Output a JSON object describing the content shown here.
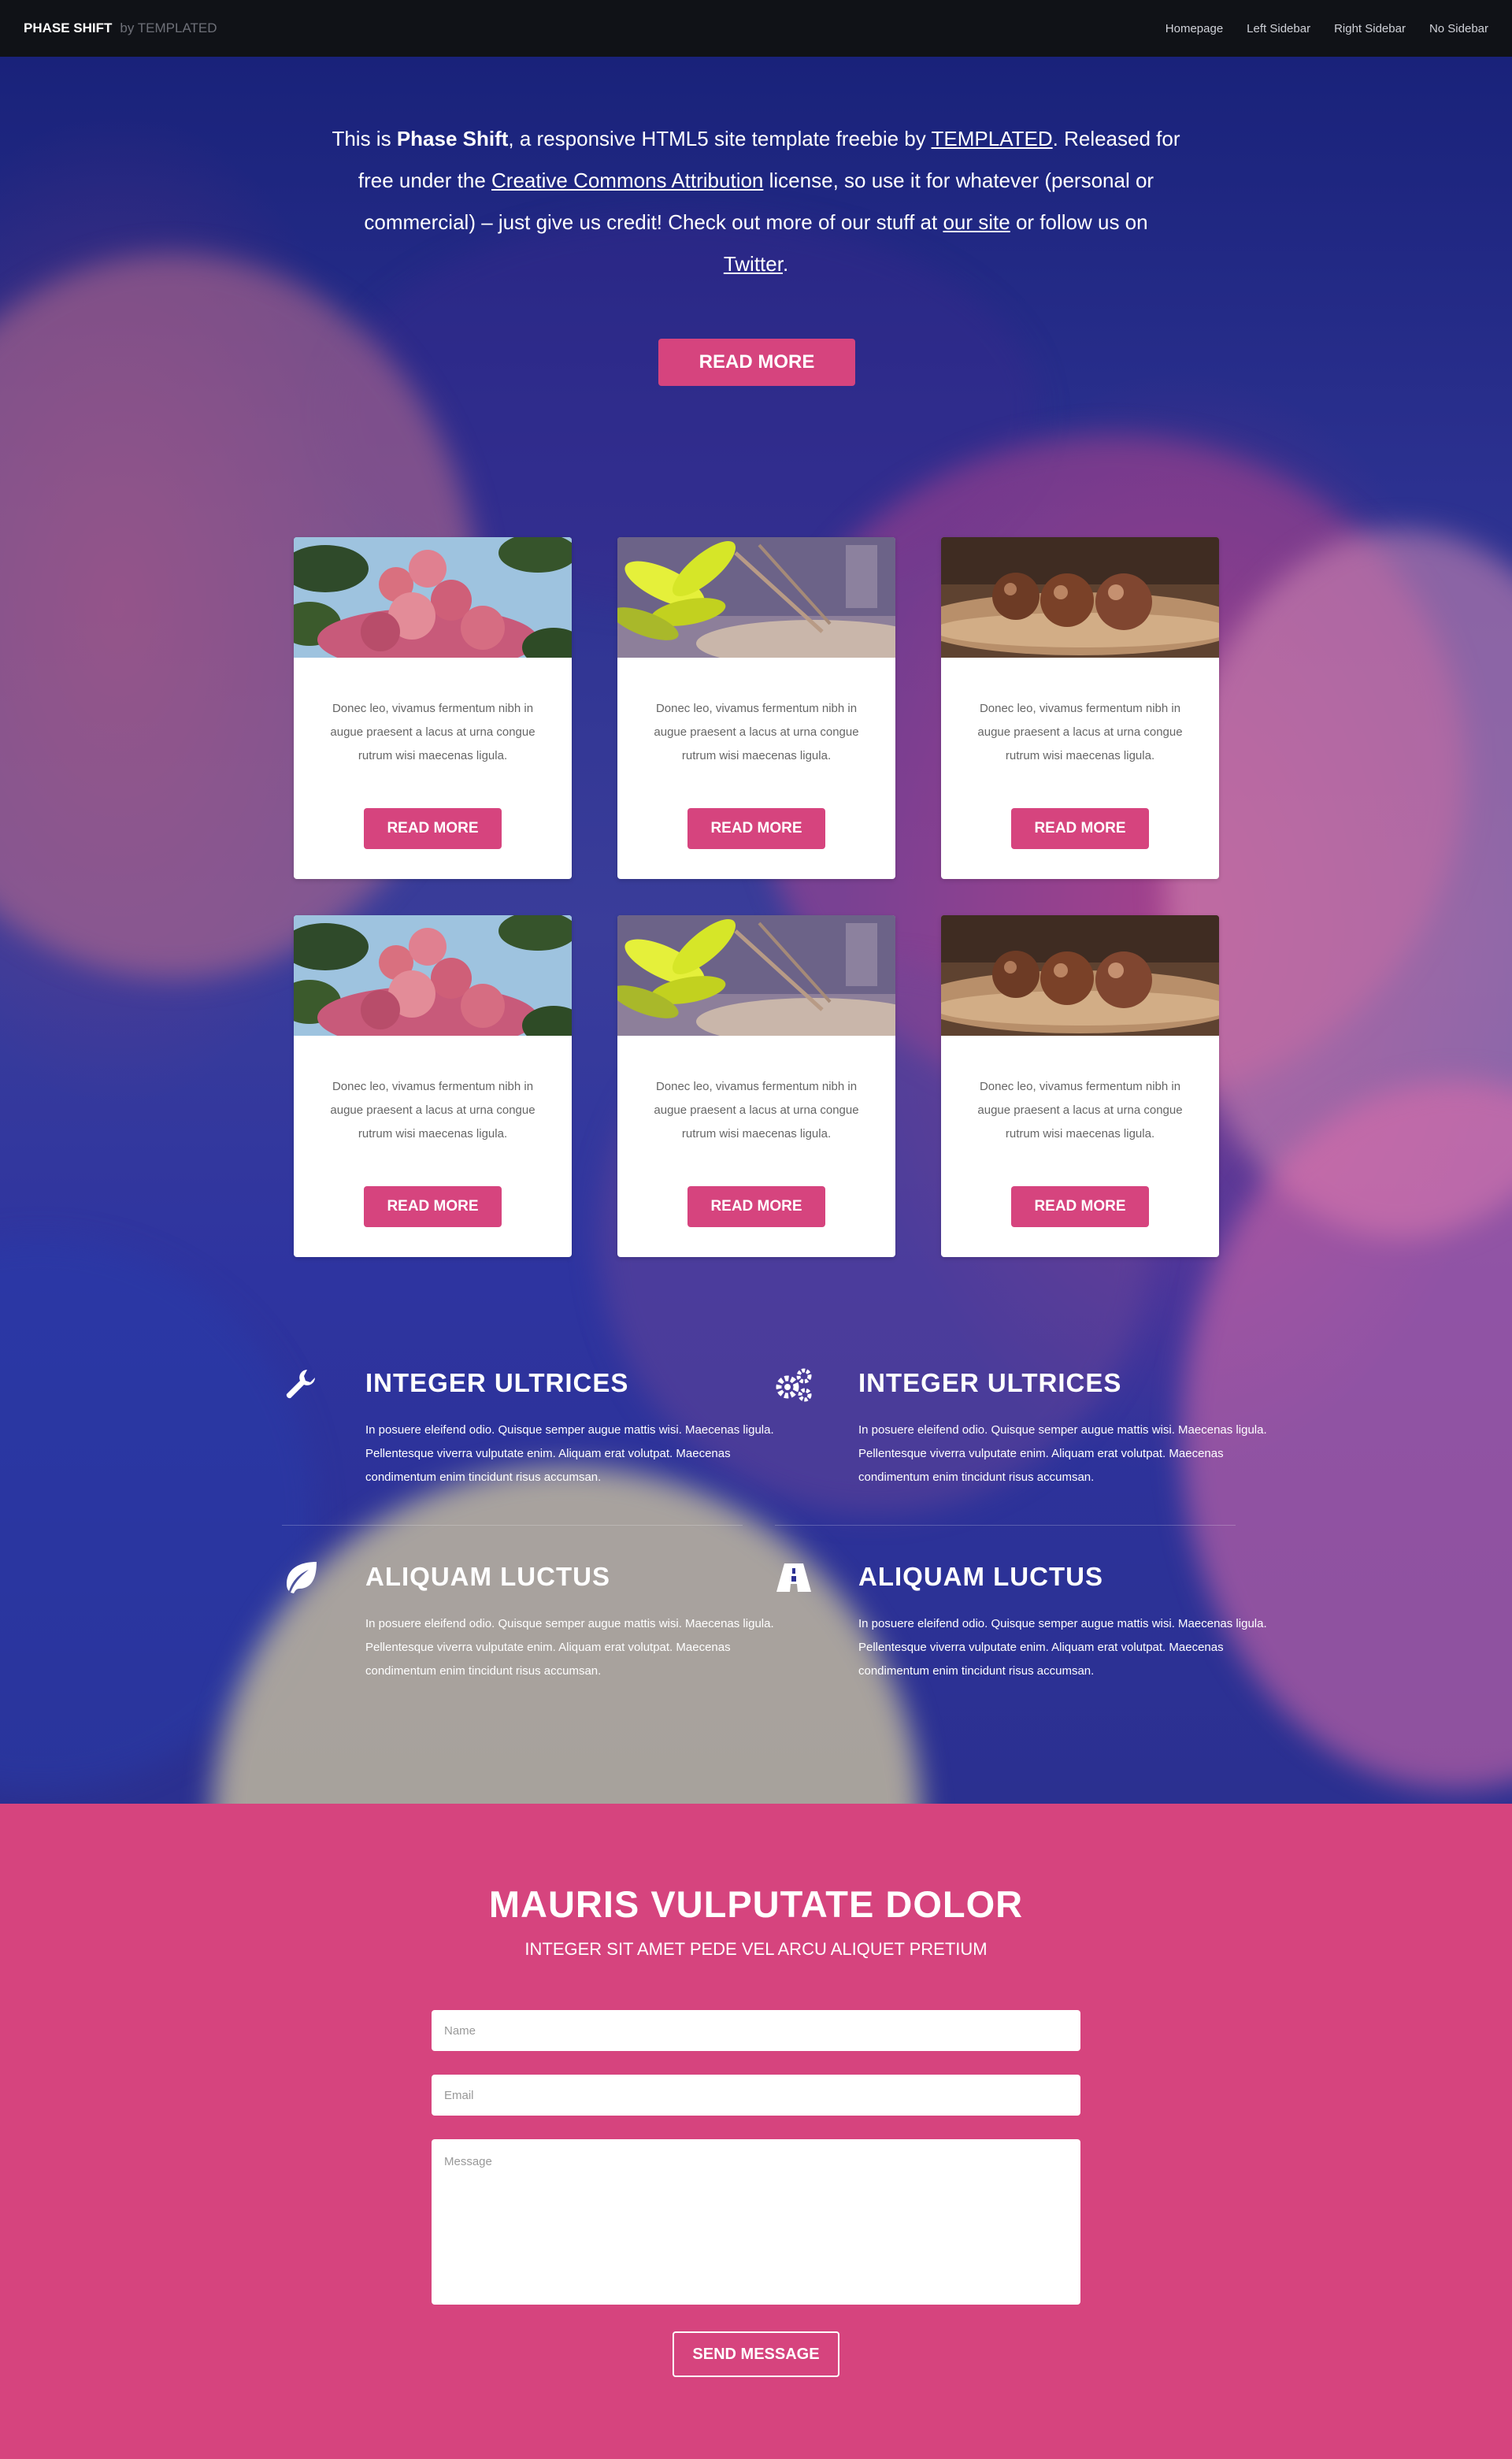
{
  "header": {
    "brand": "PHASE SHIFT",
    "brand_by": "by TEMPLATED",
    "nav": [
      {
        "label": "Homepage"
      },
      {
        "label": "Left Sidebar"
      },
      {
        "label": "Right Sidebar"
      },
      {
        "label": "No Sidebar"
      }
    ]
  },
  "intro": {
    "text_1": "This is ",
    "name": "Phase Shift",
    "text_2": ", a responsive HTML5 site template freebie by ",
    "link_templated": "TEMPLATED",
    "text_3": ". Released for free under the ",
    "link_license": "Creative Commons Attribution",
    "text_4": " license, so use it for whatever (personal or commercial) – just give us credit! Check out more of our stuff at ",
    "link_site": "our site",
    "text_5": " or follow us on ",
    "link_twitter": "Twitter",
    "text_6": ".",
    "button": "READ MORE"
  },
  "cards": [
    {
      "image": "flower-image",
      "text": "Donec leo, vivamus fermentum nibh in augue praesent a lacus at urna congue rutrum wisi maecenas ligula.",
      "button": "READ MORE"
    },
    {
      "image": "leaf-image",
      "text": "Donec leo, vivamus fermentum nibh in augue praesent a lacus at urna congue rutrum wisi maecenas ligula.",
      "button": "READ MORE"
    },
    {
      "image": "nuts-image",
      "text": "Donec leo, vivamus fermentum nibh in augue praesent a lacus at urna congue rutrum wisi maecenas ligula.",
      "button": "READ MORE"
    },
    {
      "image": "flower-image",
      "text": "Donec leo, vivamus fermentum nibh in augue praesent a lacus at urna congue rutrum wisi maecenas ligula.",
      "button": "READ MORE"
    },
    {
      "image": "leaf-image",
      "text": "Donec leo, vivamus fermentum nibh in augue praesent a lacus at urna congue rutrum wisi maecenas ligula.",
      "button": "READ MORE"
    },
    {
      "image": "nuts-image",
      "text": "Donec leo, vivamus fermentum nibh in augue praesent a lacus at urna congue rutrum wisi maecenas ligula.",
      "button": "READ MORE"
    }
  ],
  "features": [
    {
      "icon": "wrench-icon",
      "title": "INTEGER ULTRICES",
      "text": "In posuere eleifend odio. Quisque semper augue mattis wisi. Maecenas ligula. Pellentesque viverra vulputate enim. Aliquam erat volutpat. Maecenas condimentum enim tincidunt risus accumsan."
    },
    {
      "icon": "gears-icon",
      "title": "INTEGER ULTRICES",
      "text": "In posuere eleifend odio. Quisque semper augue mattis wisi. Maecenas ligula. Pellentesque viverra vulputate enim. Aliquam erat volutpat. Maecenas condimentum enim tincidunt risus accumsan."
    },
    {
      "icon": "leaf-icon",
      "title": "ALIQUAM LUCTUS",
      "text": "In posuere eleifend odio. Quisque semper augue mattis wisi. Maecenas ligula. Pellentesque viverra vulputate enim. Aliquam erat volutpat. Maecenas condimentum enim tincidunt risus accumsan."
    },
    {
      "icon": "road-icon",
      "title": "ALIQUAM LUCTUS",
      "text": "In posuere eleifend odio. Quisque semper augue mattis wisi. Maecenas ligula. Pellentesque viverra vulputate enim. Aliquam erat volutpat. Maecenas condimentum enim tincidunt risus accumsan."
    }
  ],
  "contact": {
    "title": "MAURIS VULPUTATE DOLOR",
    "subtitle": "INTEGER SIT AMET PEDE VEL ARCU ALIQUET PRETIUM",
    "name_placeholder": "Name",
    "email_placeholder": "Email",
    "message_placeholder": "Message",
    "send_label": "SEND MESSAGE"
  },
  "colors": {
    "accent": "#d6447e",
    "header_bg": "#101217"
  }
}
